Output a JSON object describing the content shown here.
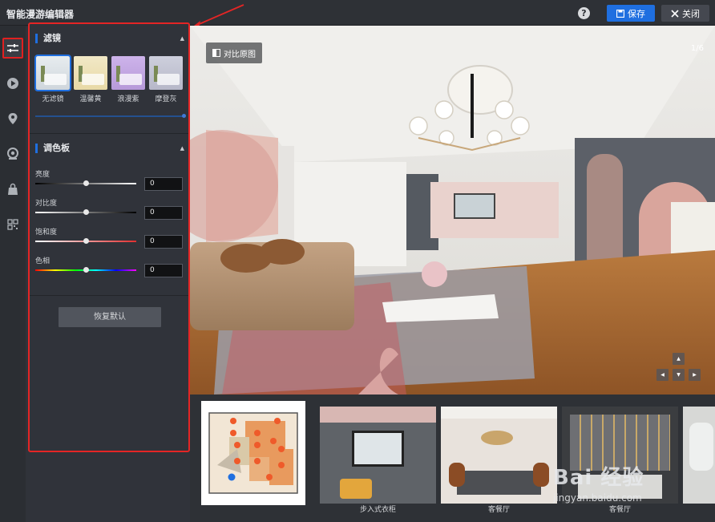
{
  "app": {
    "title": "智能漫游编辑器"
  },
  "header": {
    "help_icon": "question-circle-icon",
    "save_label": "保存",
    "close_label": "关闭"
  },
  "rail": {
    "items": [
      {
        "name": "adjust-sliders-icon",
        "active": true
      },
      {
        "name": "play-icon",
        "active": false
      },
      {
        "name": "location-pin-icon",
        "active": false
      },
      {
        "name": "hotspot-target-icon",
        "active": false
      },
      {
        "name": "shopping-bag-icon",
        "active": false
      },
      {
        "name": "grid-apps-icon",
        "active": false
      }
    ]
  },
  "panel": {
    "filter_section": {
      "title": "滤镜",
      "filters": [
        {
          "label": "无滤镜",
          "tint": "#cfd6dc",
          "selected": true
        },
        {
          "label": "温馨黄",
          "tint": "#e8d9a6",
          "selected": false
        },
        {
          "label": "浪漫紫",
          "tint": "#b79ad9",
          "selected": false
        },
        {
          "label": "摩登灰",
          "tint": "#b7b8c9",
          "selected": false
        }
      ]
    },
    "palette_section": {
      "title": "调色板",
      "adjustments": [
        {
          "label": "亮度",
          "value": "0",
          "level": 0.5
        },
        {
          "label": "对比度",
          "value": "0",
          "level": 0.5
        },
        {
          "label": "饱和度",
          "value": "0",
          "level": 0.5
        },
        {
          "label": "色相",
          "value": "0",
          "level": 0.5
        }
      ]
    },
    "reset_label": "恢复默认"
  },
  "viewer": {
    "compare_label": "对比原图",
    "page_indicator": "1/6"
  },
  "scenes": [
    {
      "caption": ""
    },
    {
      "caption": "步入式衣柜"
    },
    {
      "caption": "客餐厅"
    },
    {
      "caption": "客餐厅"
    },
    {
      "caption": ""
    }
  ],
  "watermark": {
    "brand": "Bai 经验",
    "site": "jingyan.baidu.com"
  },
  "colors": {
    "accent": "#1f6fe0",
    "highlight_border": "#e42525",
    "panel_bg": "#30333a"
  }
}
